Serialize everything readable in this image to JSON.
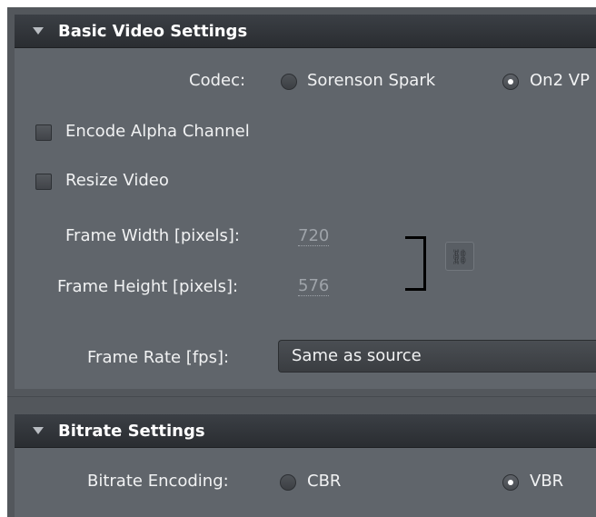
{
  "basic_video": {
    "header": "Basic Video Settings",
    "codec_label": "Codec:",
    "codec_options": [
      "Sorenson Spark",
      "On2 VP"
    ],
    "codec_selected": "On2 VP",
    "alpha_label": "Encode Alpha Channel",
    "alpha_checked": false,
    "resize_label": "Resize Video",
    "resize_checked": false,
    "width_label": "Frame Width [pixels]:",
    "width_value": "720",
    "height_label": "Frame Height [pixels]:",
    "height_value": "576",
    "constrain_icon": "chain-link-icon",
    "frame_rate_label": "Frame Rate [fps]:",
    "frame_rate_value": "Same as source"
  },
  "bitrate": {
    "header": "Bitrate Settings",
    "encoding_label": "Bitrate Encoding:",
    "options": [
      "CBR",
      "VBR"
    ],
    "selected": "VBR"
  },
  "colors": {
    "panel_bg": "#60656b",
    "header_bg": "#2f3237",
    "text": "#f1f2f3",
    "disabled_text": "#9ea3a9"
  }
}
